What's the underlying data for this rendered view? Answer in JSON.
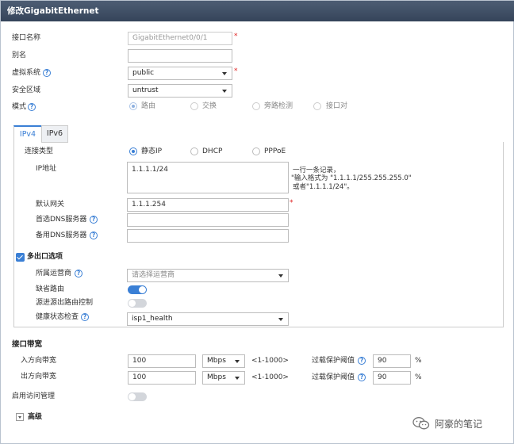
{
  "window": {
    "title": "修改GigabitEthernet"
  },
  "form": {
    "interface_name_label": "接口名称",
    "interface_name_value": "GigabitEthernet0/0/1",
    "alias_label": "别名",
    "alias_value": "",
    "vsys_label": "虚拟系统",
    "vsys_value": "public",
    "zone_label": "安全区域",
    "zone_value": "untrust",
    "mode_label": "模式",
    "mode_options": [
      "路由",
      "交换",
      "旁路检测",
      "接口对"
    ],
    "mode_selected": "路由",
    "required_mark": "*"
  },
  "tabs": [
    {
      "label": "IPv4",
      "active": true
    },
    {
      "label": "IPv6",
      "active": false
    }
  ],
  "ipv4": {
    "conn_type_label": "连接类型",
    "conn_type_options": [
      "静态IP",
      "DHCP",
      "PPPoE"
    ],
    "conn_type_selected": "静态IP",
    "ip_label": "IP地址",
    "ip_value": "1.1.1.1/24",
    "ip_hint": [
      "一行一条记录，",
      "\"输入格式为 \"1.1.1.1/255.255.255.0\"",
      "或者\"1.1.1.1/24\"。"
    ],
    "gateway_label": "默认网关",
    "gateway_value": "1.1.1.254",
    "dns1_label": "首选DNS服务器",
    "dns1_value": "",
    "dns2_label": "备用DNS服务器",
    "dns2_value": "",
    "multi_exit_label": "多出口选项",
    "multi_exit_checked": true,
    "isp_label": "所属运营商",
    "isp_placeholder": "请选择运营商",
    "default_route_label": "缺省路由",
    "default_route_on": true,
    "src_route_label": "源进源出路由控制",
    "src_route_on": false,
    "health_label": "健康状态检查",
    "health_value": "isp1_health"
  },
  "bandwidth": {
    "section_label": "接口带宽",
    "in_label": "入方向带宽",
    "in_value": "100",
    "in_unit": "Mbps",
    "in_range": "<1-1000>",
    "in_threshold_label": "过载保护阈值",
    "in_threshold_value": "90",
    "out_label": "出方向带宽",
    "out_value": "100",
    "out_unit": "Mbps",
    "out_range": "<1-1000>",
    "out_threshold_label": "过载保护阈值",
    "out_threshold_value": "90",
    "percent": "%"
  },
  "access": {
    "label": "启用访问管理",
    "on": false
  },
  "advanced": {
    "label": "高级"
  },
  "watermark": {
    "text": "阿豪的笔记"
  },
  "colors": {
    "accent": "#3a7fd5",
    "title_bar": "#3d4c63",
    "required": "#e02020"
  }
}
